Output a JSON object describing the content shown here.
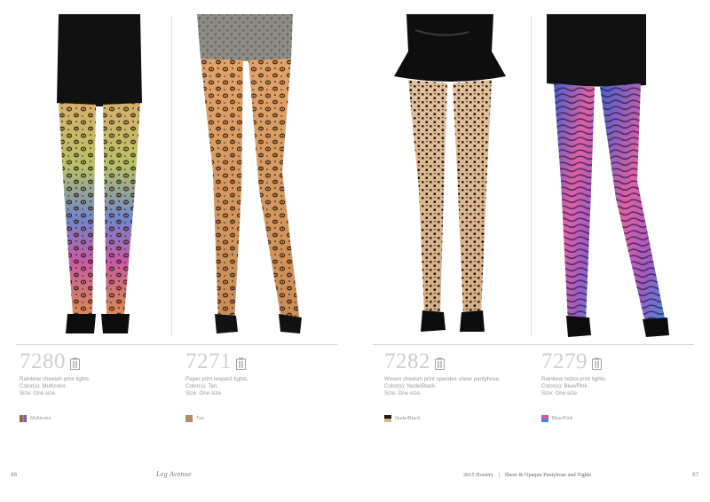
{
  "products": [
    {
      "code": "7280",
      "icon": "package-icon",
      "description": [
        "Rainbow cheetah print tights.",
        "Color(s): Multicolor.",
        "Size: One size."
      ],
      "swatch": {
        "label": "Multicolor",
        "colors": [
          "#8a6b3a",
          "#c26a94",
          "#5566b8"
        ]
      }
    },
    {
      "code": "7271",
      "icon": "package-icon",
      "description": [
        "Paper print leopard tights.",
        "Color(s): Tan.",
        "Size: One size."
      ],
      "swatch": {
        "label": "Tan",
        "colors": [
          "#b78d62"
        ]
      }
    },
    {
      "code": "7282",
      "icon": "package-icon",
      "description": [
        "Woven cheetah print spandex sheer pantyhose.",
        "Color(s): Nude/Black.",
        "Size: One size."
      ],
      "swatch": {
        "label": "Nude/Black",
        "colors": [
          "#d7b690",
          "#1a1a1a"
        ]
      }
    },
    {
      "code": "7279",
      "icon": "package-icon",
      "description": [
        "Rainbow zebra print tights.",
        "Color(s): Blue/Pink.",
        "Size: One size."
      ],
      "swatch": {
        "label": "Blue/Pink",
        "colors": [
          "#d05aa0",
          "#3e8ed8"
        ]
      }
    }
  ],
  "footer": {
    "left_page": "86",
    "logo": "Leg Avenue",
    "section_year": "2015 Hosiery",
    "section_divider": "|",
    "section_title": "Sheer & Opaque Pantyhose and Tights",
    "right_page": "87"
  },
  "colors": {
    "code_gray": "#cfcfcf",
    "text_gray": "#9a9a9a",
    "rule": "#d6d6d6"
  }
}
